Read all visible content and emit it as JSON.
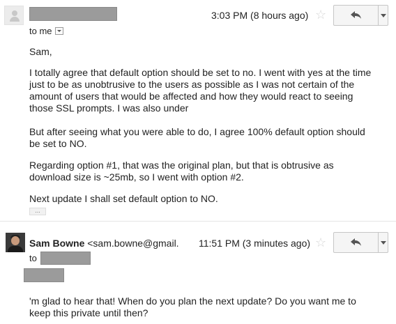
{
  "message1": {
    "timestamp": "3:03 PM (8 hours ago)",
    "to_label": "to me",
    "greeting": "Sam,",
    "paragraphs": [
      "I totally agree that default option should be set to no. I went with yes at the time just to be as unobtrusive to the users as possible as I was not certain of the amount of users that would be affected and how they would react to seeing those SSL prompts. I was also under",
      "But after seeing what you were able to do, I agree 100% default option should be set to NO.",
      "Regarding option #1, that was the original plan, but that is obtrusive as download size is ~25mb, so I went with option #2.",
      "Next update I shall set default option to NO."
    ],
    "ellipsis": "..."
  },
  "message2": {
    "sender_name": "Sam Bowne",
    "sender_email": "<sam.bowne@gmail.",
    "timestamp": "11:51 PM (3 minutes ago)",
    "to_label": "to",
    "body_lines": [
      "'m glad to hear that!  When do you plan the next update?  Do you want me to",
      "keep this private until then?"
    ]
  },
  "icons": {
    "star": "☆",
    "reply": "reply-arrow-icon",
    "more": "chevron-down-icon"
  },
  "colors": {
    "redaction": "#9b9b9b",
    "star": "#d6d6d6",
    "button_bg": "#f5f5f5"
  }
}
